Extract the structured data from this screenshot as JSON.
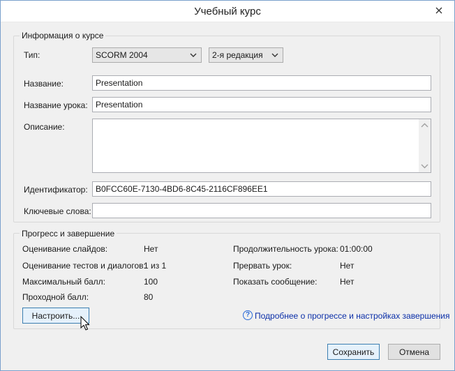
{
  "window": {
    "title": "Учебный курс"
  },
  "course_info": {
    "legend": "Информация о курсе",
    "type_label": "Тип:",
    "type_value": "SCORM 2004",
    "edition_value": "2-я редакция",
    "name_label": "Название:",
    "name_value": "Presentation",
    "lesson_name_label": "Название урока:",
    "lesson_name_value": "Presentation",
    "description_label": "Описание:",
    "description_value": "",
    "identifier_label": "Идентификатор:",
    "identifier_value": "B0FCC60E-7130-4BD6-8C45-2116CF896EE1",
    "keywords_label": "Ключевые слова:",
    "keywords_value": ""
  },
  "progress": {
    "legend": "Прогресс и завершение",
    "left": [
      {
        "label": "Оценивание слайдов:",
        "value": "Нет"
      },
      {
        "label": "Оценивание тестов и диалогов:",
        "value": "1 из 1"
      },
      {
        "label": "Максимальный балл:",
        "value": "100"
      },
      {
        "label": "Проходной балл:",
        "value": "80"
      }
    ],
    "right": [
      {
        "label": "Продолжительность урока:",
        "value": "01:00:00"
      },
      {
        "label": "Прервать урок:",
        "value": "Нет"
      },
      {
        "label": "Показать сообщение:",
        "value": "Нет"
      }
    ],
    "configure_button": "Настроить...",
    "help_icon": "?",
    "help_link": "Подробнее о прогрессе и настройках завершения"
  },
  "footer": {
    "save_button": "Сохранить",
    "cancel_button": "Отмена"
  },
  "icons": {
    "close": "close-icon",
    "help": "help-circle-icon",
    "cursor": "mouse-pointer-icon",
    "dropdown": "chevron-down-icon"
  },
  "colors": {
    "link": "#0b2fa8",
    "accent_border": "#3c7fb1",
    "window_bg": "#f0f0f0"
  }
}
